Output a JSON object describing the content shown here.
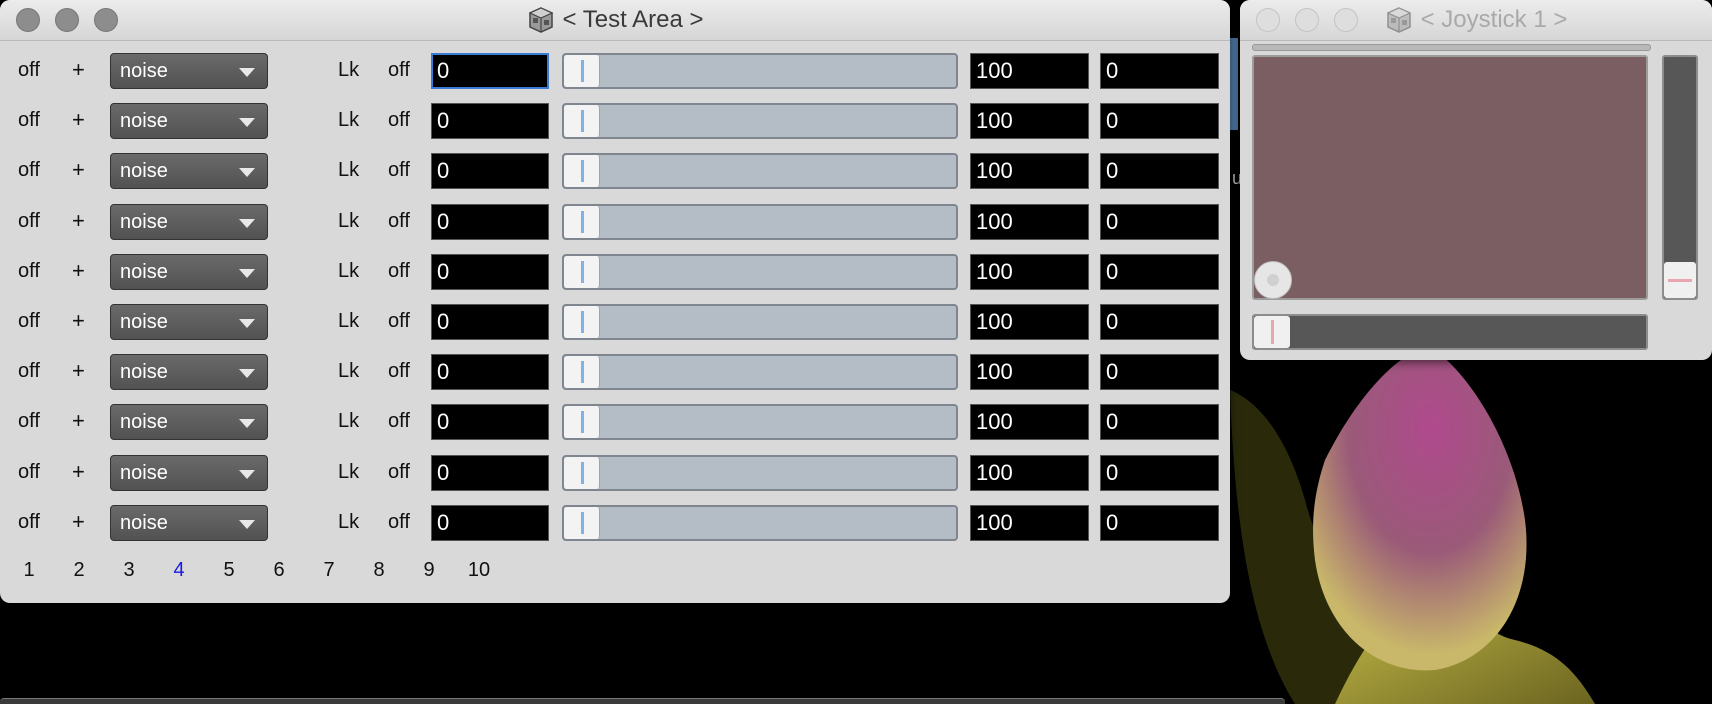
{
  "test_window": {
    "title": "< Test Area >",
    "title_icon": "cube-app-icon",
    "rows": [
      {
        "state": "off",
        "add": "+",
        "mode": "noise",
        "lock": "Lk",
        "lock_state": "off",
        "value": "0",
        "max": "100",
        "out": "0",
        "slider_fraction": 0
      },
      {
        "state": "off",
        "add": "+",
        "mode": "noise",
        "lock": "Lk",
        "lock_state": "off",
        "value": "0",
        "max": "100",
        "out": "0",
        "slider_fraction": 0
      },
      {
        "state": "off",
        "add": "+",
        "mode": "noise",
        "lock": "Lk",
        "lock_state": "off",
        "value": "0",
        "max": "100",
        "out": "0",
        "slider_fraction": 0
      },
      {
        "state": "off",
        "add": "+",
        "mode": "noise",
        "lock": "Lk",
        "lock_state": "off",
        "value": "0",
        "max": "100",
        "out": "0",
        "slider_fraction": 0
      },
      {
        "state": "off",
        "add": "+",
        "mode": "noise",
        "lock": "Lk",
        "lock_state": "off",
        "value": "0",
        "max": "100",
        "out": "0",
        "slider_fraction": 0
      },
      {
        "state": "off",
        "add": "+",
        "mode": "noise",
        "lock": "Lk",
        "lock_state": "off",
        "value": "0",
        "max": "100",
        "out": "0",
        "slider_fraction": 0
      },
      {
        "state": "off",
        "add": "+",
        "mode": "noise",
        "lock": "Lk",
        "lock_state": "off",
        "value": "0",
        "max": "100",
        "out": "0",
        "slider_fraction": 0
      },
      {
        "state": "off",
        "add": "+",
        "mode": "noise",
        "lock": "Lk",
        "lock_state": "off",
        "value": "0",
        "max": "100",
        "out": "0",
        "slider_fraction": 0
      },
      {
        "state": "off",
        "add": "+",
        "mode": "noise",
        "lock": "Lk",
        "lock_state": "off",
        "value": "0",
        "max": "100",
        "out": "0",
        "slider_fraction": 0
      },
      {
        "state": "off",
        "add": "+",
        "mode": "noise",
        "lock": "Lk",
        "lock_state": "off",
        "value": "0",
        "max": "100",
        "out": "0",
        "slider_fraction": 0
      }
    ],
    "pages": [
      "1",
      "2",
      "3",
      "4",
      "5",
      "6",
      "7",
      "8",
      "9",
      "10"
    ],
    "active_page": "4"
  },
  "joystick_window": {
    "title": "< Joystick 1 >",
    "title_icon": "cube-app-icon",
    "pad_color": "#7a5e62"
  },
  "colors": {
    "active_page": "#1a1ae6",
    "focus_ring": "#3b7bd6",
    "slider_track": "#b4bcc6"
  }
}
